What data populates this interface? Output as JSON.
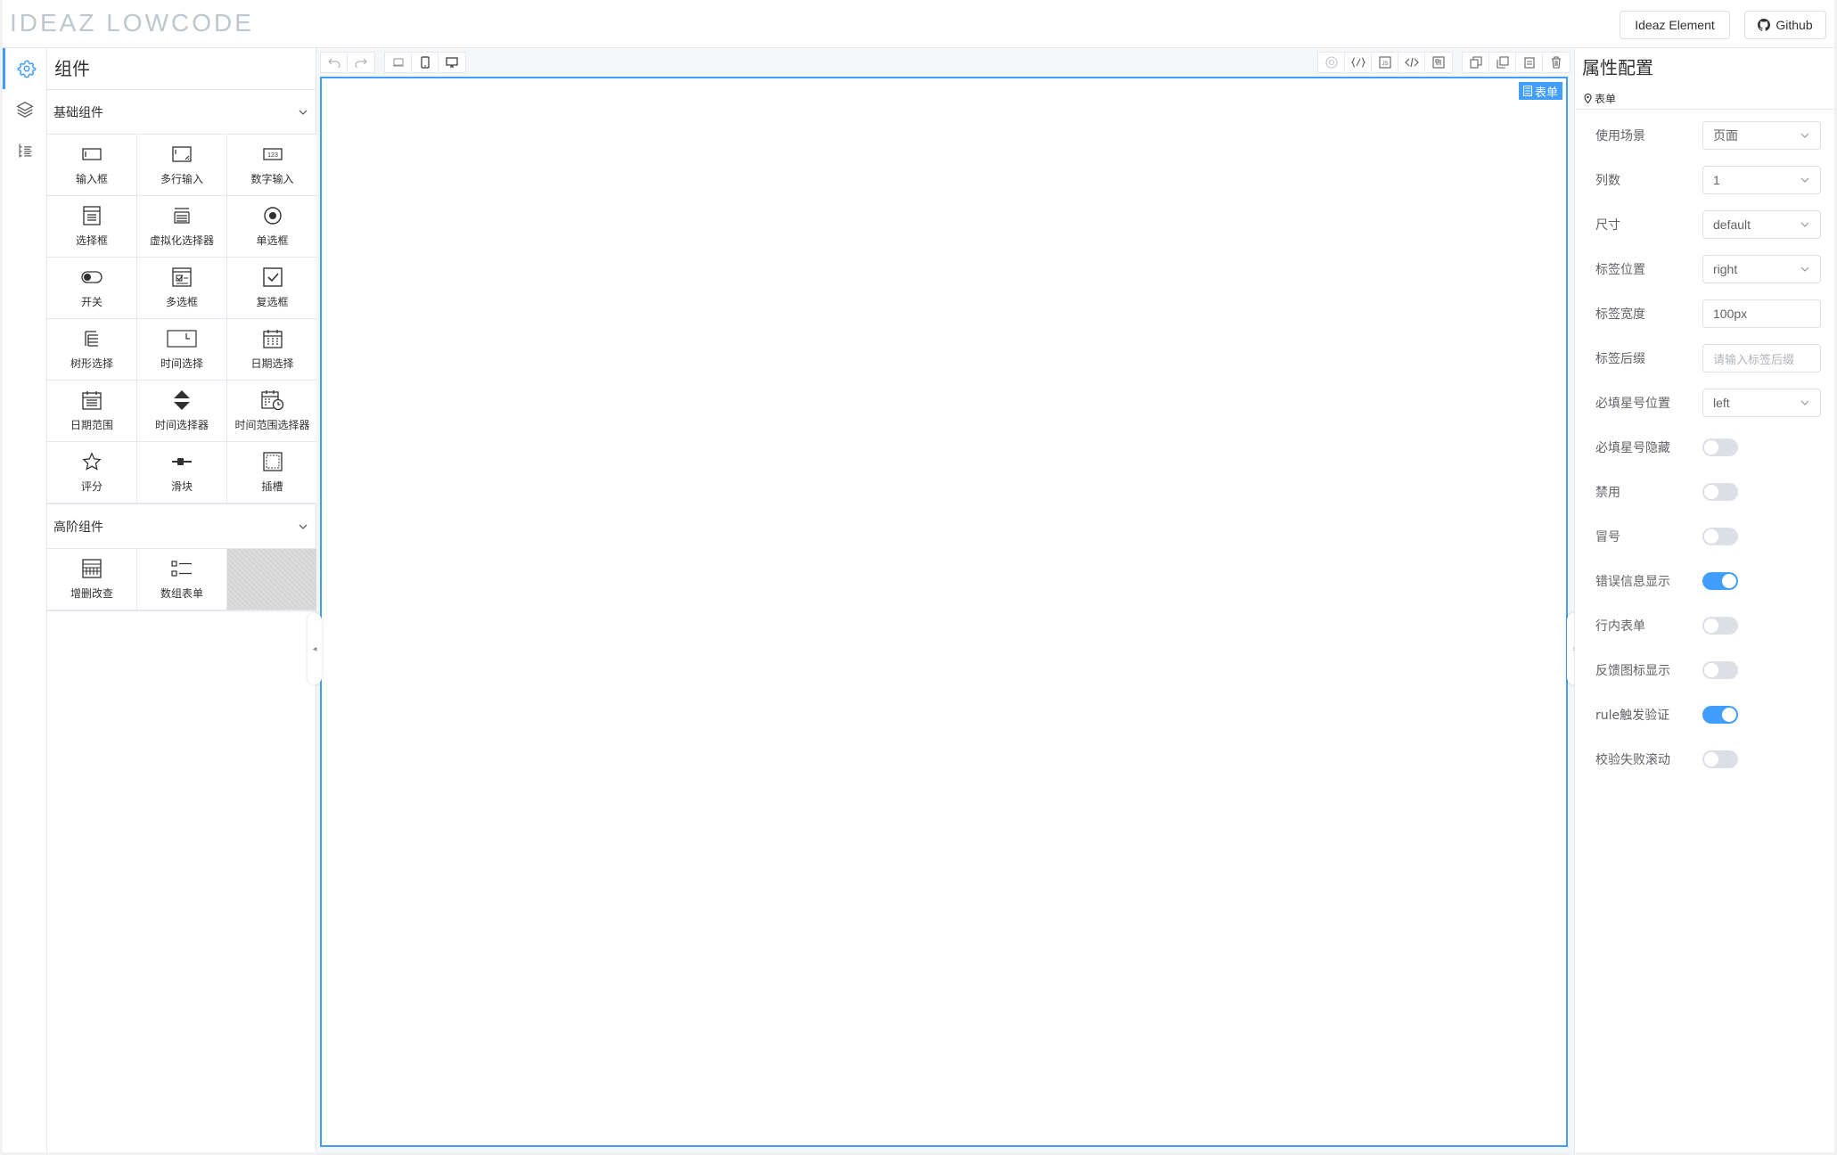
{
  "header": {
    "logo_text": "IDEAZ LOWCODE",
    "buttons": [
      {
        "label": "Ideaz Element"
      },
      {
        "label": "Github"
      }
    ]
  },
  "rail": {
    "items": [
      {
        "icon": "gear-icon",
        "active": true
      },
      {
        "icon": "layers-icon",
        "active": false
      },
      {
        "icon": "outline-tree-icon",
        "active": false
      }
    ]
  },
  "left_panel": {
    "title": "组件",
    "groups": [
      {
        "title": "基础组件",
        "items": [
          {
            "label": "输入框",
            "icon": "input-icon"
          },
          {
            "label": "多行输入",
            "icon": "textarea-icon"
          },
          {
            "label": "数字输入",
            "icon": "number-input-icon"
          },
          {
            "label": "选择框",
            "icon": "select-icon"
          },
          {
            "label": "虚拟化选择器",
            "icon": "virtual-select-icon"
          },
          {
            "label": "单选框",
            "icon": "radio-icon"
          },
          {
            "label": "开关",
            "icon": "switch-icon"
          },
          {
            "label": "多选框",
            "icon": "multi-select-icon"
          },
          {
            "label": "复选框",
            "icon": "checkbox-icon"
          },
          {
            "label": "树形选择",
            "icon": "tree-select-icon"
          },
          {
            "label": "时间选择",
            "icon": "time-select-icon"
          },
          {
            "label": "日期选择",
            "icon": "date-picker-icon"
          },
          {
            "label": "日期范围",
            "icon": "date-range-icon"
          },
          {
            "label": "时间选择器",
            "icon": "time-picker-icon"
          },
          {
            "label": "时间范围选择器",
            "icon": "time-range-picker-icon"
          },
          {
            "label": "评分",
            "icon": "star-icon"
          },
          {
            "label": "滑块",
            "icon": "slider-icon"
          },
          {
            "label": "插槽",
            "icon": "slot-icon"
          }
        ]
      },
      {
        "title": "高阶组件",
        "items": [
          {
            "label": "增删改查",
            "icon": "crud-table-icon"
          },
          {
            "label": "数组表单",
            "icon": "array-form-icon"
          }
        ]
      }
    ]
  },
  "toolbar": {
    "left_icons": [
      "undo-icon",
      "redo-icon"
    ],
    "device_icons": [
      "laptop-icon",
      "mobile-icon",
      "desktop-icon"
    ],
    "right_icons": [
      "preview-icon",
      "json-icon",
      "js-icon",
      "code-icon",
      "import-icon",
      "copy-icon",
      "duplicate-icon",
      "paste-icon",
      "delete-icon"
    ]
  },
  "canvas": {
    "form_tag": "表单"
  },
  "right_panel": {
    "title": "属性配置",
    "tab": "表单",
    "fields": [
      {
        "label": "使用场景",
        "type": "select",
        "value": "页面"
      },
      {
        "label": "列数",
        "type": "select",
        "value": "1"
      },
      {
        "label": "尺寸",
        "type": "select",
        "value": "default"
      },
      {
        "label": "标签位置",
        "type": "select",
        "value": "right"
      },
      {
        "label": "标签宽度",
        "type": "input",
        "value": "100px"
      },
      {
        "label": "标签后缀",
        "type": "input",
        "value": "",
        "placeholder": "请输入标签后缀"
      },
      {
        "label": "必填星号位置",
        "type": "select",
        "value": "left"
      },
      {
        "label": "必填星号隐藏",
        "type": "switch",
        "value": false
      },
      {
        "label": "禁用",
        "type": "switch",
        "value": false
      },
      {
        "label": "冒号",
        "type": "switch",
        "value": false
      },
      {
        "label": "错误信息显示",
        "type": "switch",
        "value": true
      },
      {
        "label": "行内表单",
        "type": "switch",
        "value": false
      },
      {
        "label": "反馈图标显示",
        "type": "switch",
        "value": false
      },
      {
        "label": "rule触发验证",
        "type": "switch",
        "value": true
      },
      {
        "label": "校验失败滚动",
        "type": "switch",
        "value": false
      }
    ]
  },
  "colors": {
    "accent": "#409eff",
    "border": "#e4e7ed"
  }
}
